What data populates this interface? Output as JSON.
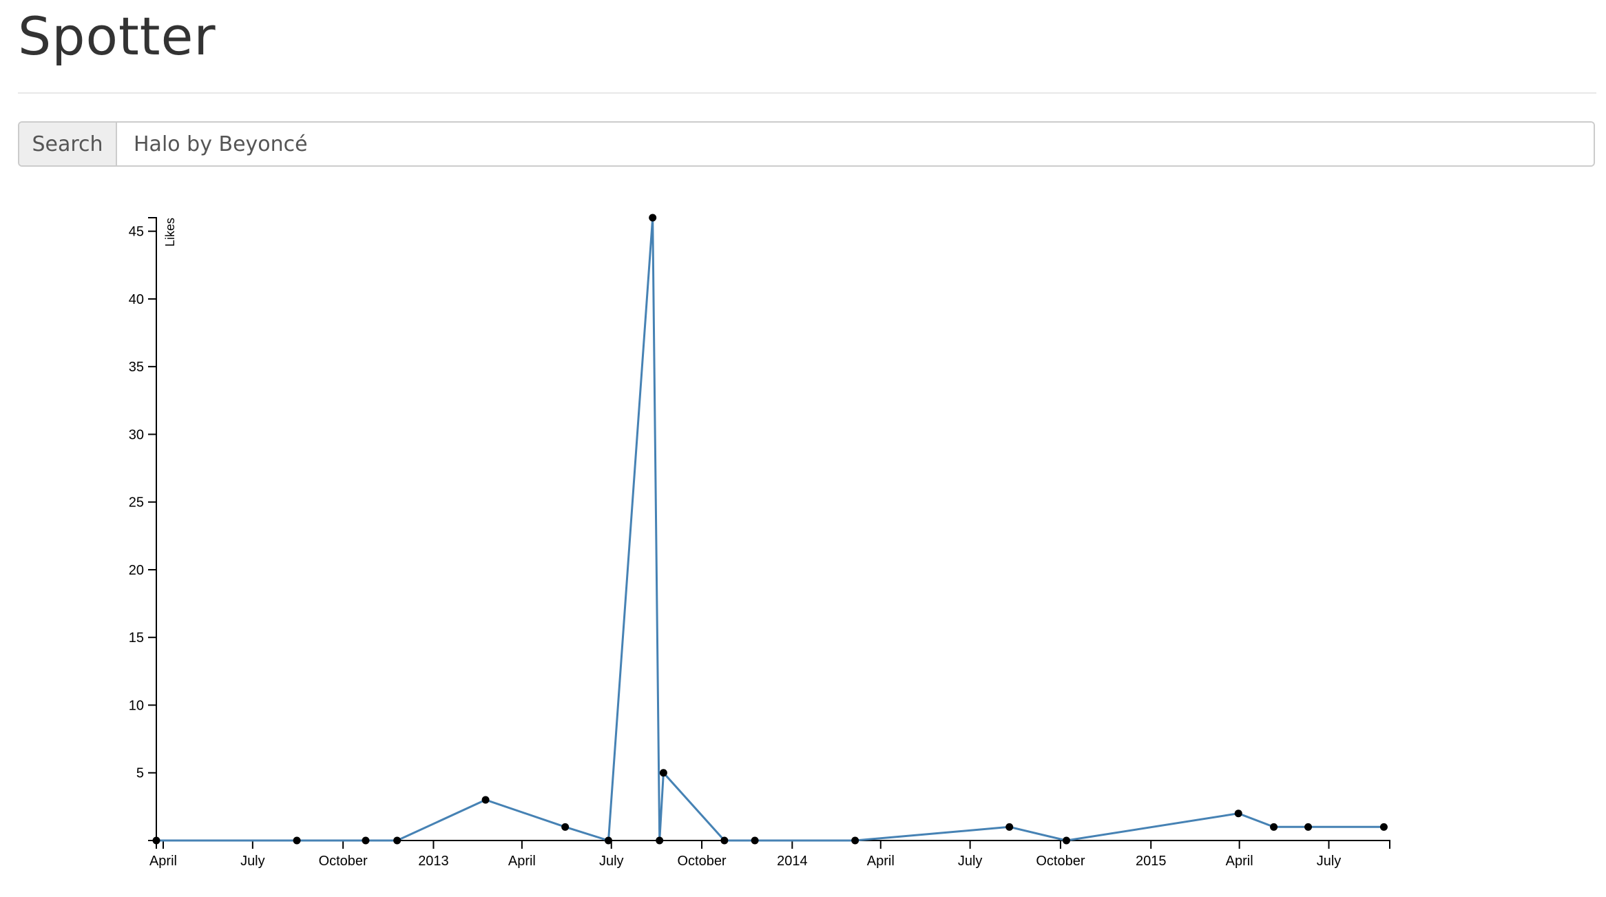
{
  "app": {
    "title": "Spotter"
  },
  "search": {
    "addon_label": "Search",
    "value": "Halo by Beyoncé"
  },
  "chart_data": {
    "type": "line",
    "ylabel": "Likes",
    "xlabel": "",
    "ylim": [
      0,
      46
    ],
    "xlim": [
      "2012-03-25",
      "2015-09-01"
    ],
    "y_ticks": [
      5,
      10,
      15,
      20,
      25,
      30,
      35,
      40,
      45
    ],
    "x_ticks": [
      {
        "date": "2012-04-01",
        "label": "April"
      },
      {
        "date": "2012-07-01",
        "label": "July"
      },
      {
        "date": "2012-10-01",
        "label": "October"
      },
      {
        "date": "2013-01-01",
        "label": "2013"
      },
      {
        "date": "2013-04-01",
        "label": "April"
      },
      {
        "date": "2013-07-01",
        "label": "July"
      },
      {
        "date": "2013-10-01",
        "label": "October"
      },
      {
        "date": "2014-01-01",
        "label": "2014"
      },
      {
        "date": "2014-04-01",
        "label": "April"
      },
      {
        "date": "2014-07-01",
        "label": "July"
      },
      {
        "date": "2014-10-01",
        "label": "October"
      },
      {
        "date": "2015-01-01",
        "label": "2015"
      },
      {
        "date": "2015-04-01",
        "label": "April"
      },
      {
        "date": "2015-07-01",
        "label": "July"
      }
    ],
    "series": [
      {
        "color": "#4682b4",
        "points": [
          {
            "x": "2012-03-25",
            "y": 0
          },
          {
            "x": "2012-08-15",
            "y": 0
          },
          {
            "x": "2012-10-24",
            "y": 0
          },
          {
            "x": "2012-11-25",
            "y": 0
          },
          {
            "x": "2013-02-23",
            "y": 3
          },
          {
            "x": "2013-05-15",
            "y": 1
          },
          {
            "x": "2013-06-28",
            "y": 0
          },
          {
            "x": "2013-08-12",
            "y": 46
          },
          {
            "x": "2013-08-19",
            "y": 0
          },
          {
            "x": "2013-08-23",
            "y": 5
          },
          {
            "x": "2013-10-24",
            "y": 0
          },
          {
            "x": "2013-11-24",
            "y": 0
          },
          {
            "x": "2014-03-06",
            "y": 0
          },
          {
            "x": "2014-08-10",
            "y": 1
          },
          {
            "x": "2014-10-07",
            "y": 0
          },
          {
            "x": "2015-03-31",
            "y": 2
          },
          {
            "x": "2015-05-06",
            "y": 1
          },
          {
            "x": "2015-06-10",
            "y": 1
          },
          {
            "x": "2015-08-26",
            "y": 1
          }
        ]
      }
    ]
  }
}
